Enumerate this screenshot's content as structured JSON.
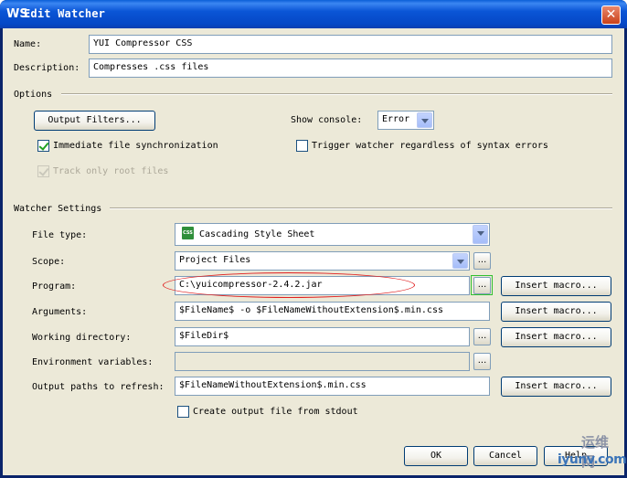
{
  "window": {
    "title": "Edit Watcher",
    "icon_glyph": "WS",
    "close_glyph": "✕"
  },
  "fields": {
    "name_label": "Name:",
    "name_value": "YUI Compressor CSS",
    "description_label": "Description:",
    "description_value": "Compresses .css files"
  },
  "options": {
    "title": "Options",
    "output_filters_button": "Output Filters...",
    "show_console_label": "Show console:",
    "show_console_value": "Error",
    "immediate_sync_label": "Immediate file synchronization",
    "immediate_sync_checked": true,
    "trigger_watcher_label": "Trigger watcher regardless of syntax errors",
    "trigger_watcher_checked": false,
    "track_root_label": "Track only root files",
    "track_root_checked": true
  },
  "watcher_settings": {
    "title": "Watcher Settings",
    "file_type_label": "File type:",
    "file_type_value": "Cascading Style Sheet",
    "file_type_icon_text": "CSS",
    "scope_label": "Scope:",
    "scope_value": "Project Files",
    "program_label": "Program:",
    "program_value": "C:\\yuicompressor-2.4.2.jar",
    "arguments_label": "Arguments:",
    "arguments_value": "$FileName$ -o $FileNameWithoutExtension$.min.css",
    "working_dir_label": "Working directory:",
    "working_dir_value": "$FileDir$",
    "env_vars_label": "Environment variables:",
    "env_vars_value": "",
    "output_paths_label": "Output paths to refresh:",
    "output_paths_value": "$FileNameWithoutExtension$.min.css",
    "create_output_label": "Create output file from stdout",
    "create_output_checked": false,
    "insert_macro_label": "Insert macro...",
    "browse_glyph": "...",
    "icons": {
      "file_type": "css-file-icon",
      "browse": "ellipsis-icon",
      "dropdown": "chevron-down-icon"
    }
  },
  "footer": {
    "ok_label": "OK",
    "cancel_label": "Cancel",
    "help_label": "Help"
  },
  "watermark": {
    "line1": "运维网",
    "line2": "iyunv.com"
  },
  "colors": {
    "titlebar": "#0a55d6",
    "dialog_bg": "#ece9d8",
    "highlight_oval": "#e02020",
    "highlight_box": "#30c030"
  }
}
